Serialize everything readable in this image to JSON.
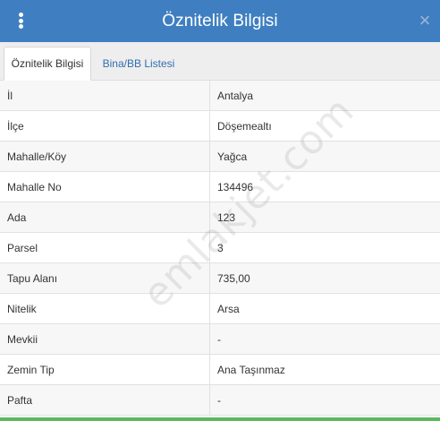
{
  "header": {
    "title": "Öznitelik Bilgisi",
    "menu_icon": "vertical-dots-icon",
    "close_label": "×"
  },
  "tabs": [
    {
      "label": "Öznitelik Bilgisi",
      "active": true
    },
    {
      "label": "Bina/BB Listesi",
      "active": false
    }
  ],
  "attributes": [
    {
      "label": "İl",
      "value": "Antalya"
    },
    {
      "label": "İlçe",
      "value": "Döşemealtı"
    },
    {
      "label": "Mahalle/Köy",
      "value": "Yağca"
    },
    {
      "label": "Mahalle No",
      "value": "134496"
    },
    {
      "label": "Ada",
      "value": "123"
    },
    {
      "label": "Parsel",
      "value": "3"
    },
    {
      "label": "Tapu Alanı",
      "value": "735,00"
    },
    {
      "label": "Nitelik",
      "value": "Arsa"
    },
    {
      "label": "Mevkii",
      "value": "-"
    },
    {
      "label": "Zemin Tip",
      "value": "Ana Taşınmaz"
    },
    {
      "label": "Pafta",
      "value": "-"
    }
  ],
  "watermark": "emlakjet.com",
  "colors": {
    "header_bg": "#3f7fc1",
    "tab_link": "#2f6fb0",
    "accent_bottom": "#5cb85c"
  }
}
